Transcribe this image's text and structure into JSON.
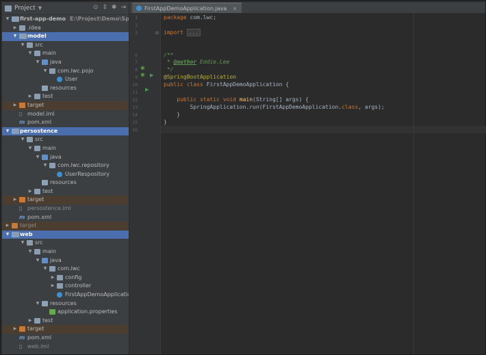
{
  "sidebar": {
    "header": {
      "title": "Project"
    },
    "tree": [
      {
        "depth": 0,
        "arrow": "down",
        "icon": "module",
        "label": "first-app-demo",
        "path": "E:\\Project\\Demo\\SpringBoot\\",
        "style": "normal"
      },
      {
        "depth": 1,
        "arrow": "right",
        "icon": "folder",
        "label": ".idea",
        "style": "normal"
      },
      {
        "depth": 1,
        "arrow": "down",
        "icon": "module",
        "label": "model",
        "style": "sel"
      },
      {
        "depth": 2,
        "arrow": "down",
        "icon": "folder",
        "label": "src",
        "style": "normal"
      },
      {
        "depth": 3,
        "arrow": "down",
        "icon": "folder",
        "label": "main",
        "style": "normal"
      },
      {
        "depth": 4,
        "arrow": "down",
        "icon": "src",
        "label": "java",
        "style": "normal"
      },
      {
        "depth": 5,
        "arrow": "down",
        "icon": "pkg",
        "label": "com.lwc.pojo",
        "style": "normal"
      },
      {
        "depth": 6,
        "arrow": "",
        "icon": "class",
        "label": "User",
        "style": "normal"
      },
      {
        "depth": 4,
        "arrow": "",
        "icon": "res",
        "label": "resources",
        "style": "normal"
      },
      {
        "depth": 3,
        "arrow": "right",
        "icon": "folder",
        "label": "test",
        "style": "normal"
      },
      {
        "depth": 1,
        "arrow": "right",
        "icon": "orange",
        "label": "target",
        "style": "tgt"
      },
      {
        "depth": 1,
        "arrow": "",
        "icon": "iml",
        "label": "model.iml",
        "style": "normal"
      },
      {
        "depth": 1,
        "arrow": "",
        "icon": "pom",
        "label": "pom.xml",
        "style": "normal"
      },
      {
        "depth": 0,
        "arrow": "down",
        "icon": "module",
        "label": "persostence",
        "style": "sel"
      },
      {
        "depth": 2,
        "arrow": "down",
        "icon": "folder",
        "label": "src",
        "style": "normal"
      },
      {
        "depth": 3,
        "arrow": "down",
        "icon": "folder",
        "label": "main",
        "style": "normal"
      },
      {
        "depth": 4,
        "arrow": "down",
        "icon": "src",
        "label": "java",
        "style": "normal"
      },
      {
        "depth": 5,
        "arrow": "down",
        "icon": "pkg",
        "label": "com.lwc.repository",
        "style": "normal"
      },
      {
        "depth": 6,
        "arrow": "",
        "icon": "class",
        "label": "UserRespository",
        "style": "normal"
      },
      {
        "depth": 4,
        "arrow": "",
        "icon": "res",
        "label": "resources",
        "style": "normal"
      },
      {
        "depth": 3,
        "arrow": "right",
        "icon": "folder",
        "label": "test",
        "style": "normal"
      },
      {
        "depth": 1,
        "arrow": "right",
        "icon": "orange",
        "label": "target",
        "style": "tgt"
      },
      {
        "depth": 1,
        "arrow": "",
        "icon": "iml",
        "label": "persostence.iml",
        "style": "dim"
      },
      {
        "depth": 1,
        "arrow": "",
        "icon": "pom",
        "label": "pom.xml",
        "style": "normal"
      },
      {
        "depth": 0,
        "arrow": "right",
        "icon": "orange",
        "label": "target",
        "style": "tgt-dim"
      },
      {
        "depth": 0,
        "arrow": "down",
        "icon": "module",
        "label": "web",
        "style": "sel"
      },
      {
        "depth": 2,
        "arrow": "down",
        "icon": "folder",
        "label": "src",
        "style": "normal"
      },
      {
        "depth": 3,
        "arrow": "down",
        "icon": "folder",
        "label": "main",
        "style": "normal"
      },
      {
        "depth": 4,
        "arrow": "down",
        "icon": "src",
        "label": "java",
        "style": "normal"
      },
      {
        "depth": 5,
        "arrow": "down",
        "icon": "pkg",
        "label": "com.lwc",
        "style": "normal"
      },
      {
        "depth": 6,
        "arrow": "right",
        "icon": "pkg",
        "label": "config",
        "style": "normal"
      },
      {
        "depth": 6,
        "arrow": "right",
        "icon": "pkg",
        "label": "controller",
        "style": "normal"
      },
      {
        "depth": 6,
        "arrow": "",
        "icon": "class",
        "label": "FirstAppDemoApplication",
        "style": "normal"
      },
      {
        "depth": 4,
        "arrow": "down",
        "icon": "res",
        "label": "resources",
        "style": "normal"
      },
      {
        "depth": 5,
        "arrow": "",
        "icon": "props",
        "label": "application.properties",
        "style": "normal"
      },
      {
        "depth": 3,
        "arrow": "right",
        "icon": "folder",
        "label": "test",
        "style": "normal"
      },
      {
        "depth": 1,
        "arrow": "right",
        "icon": "orange",
        "label": "target",
        "style": "tgt"
      },
      {
        "depth": 1,
        "arrow": "",
        "icon": "pom",
        "label": "pom.xml",
        "style": "normal"
      },
      {
        "depth": 1,
        "arrow": "",
        "icon": "iml",
        "label": "web.iml",
        "style": "dim"
      }
    ]
  },
  "editor": {
    "tab": {
      "label": "FirstAppDemoApplication.java"
    },
    "line_numbers": [
      "1",
      "2",
      "3",
      "",
      "",
      "6",
      "7",
      "8",
      "9",
      "10",
      "11",
      "12",
      "13",
      "14",
      "15",
      "16"
    ],
    "lines": [
      [
        {
          "t": "package ",
          "c": "kw"
        },
        {
          "t": "com.lwc;",
          "c": ""
        }
      ],
      [],
      [
        {
          "t": "import ",
          "c": "kw"
        },
        {
          "t": "...",
          "c": "fold"
        }
      ],
      [],
      [],
      [
        {
          "t": "/**",
          "c": "cmt"
        }
      ],
      [
        {
          "t": " * ",
          "c": "cmt"
        },
        {
          "t": "@author",
          "c": "tag"
        },
        {
          "t": " Eddie.Lee",
          "c": "cmt"
        }
      ],
      [
        {
          "t": " */",
          "c": "cmt"
        }
      ],
      [
        {
          "t": "@SpringBootApplication",
          "c": "ann"
        }
      ],
      [
        {
          "t": "public class ",
          "c": "kw"
        },
        {
          "t": "FirstAppDemoApplication {",
          "c": ""
        }
      ],
      [],
      [
        {
          "t": "    public static void ",
          "c": "kw"
        },
        {
          "t": "main",
          "c": "fn"
        },
        {
          "t": "(String[] args) {",
          "c": ""
        }
      ],
      [
        {
          "t": "        SpringApplication.",
          "c": ""
        },
        {
          "t": "run",
          "c": "static-m"
        },
        {
          "t": "(FirstAppDemoApplication.",
          "c": ""
        },
        {
          "t": "class",
          "c": "kw"
        },
        {
          "t": ", args);",
          "c": ""
        }
      ],
      [
        {
          "t": "    }",
          "c": ""
        }
      ],
      [
        {
          "t": "}",
          "c": ""
        }
      ],
      []
    ]
  }
}
